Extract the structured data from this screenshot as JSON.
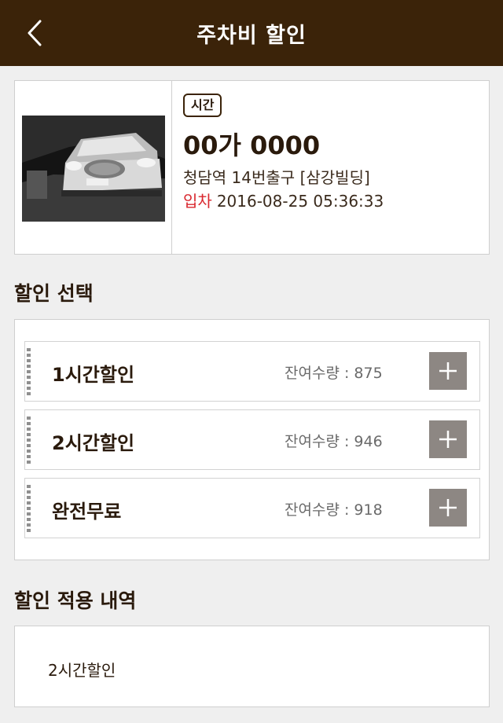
{
  "header": {
    "title": "주차비 할인",
    "back_icon": "chevron-left-icon"
  },
  "car": {
    "type_badge": "시간",
    "plate": "00가 0000",
    "location": "청담역 14번출구 [삼강빌딩]",
    "entry_label": "입차",
    "entry_time": "2016-08-25 05:36:33"
  },
  "discount_select": {
    "title": "할인 선택",
    "items": [
      {
        "name": "1시간할인",
        "remaining": "잔여수량 : 875",
        "add_icon": "plus-icon"
      },
      {
        "name": "2시간할인",
        "remaining": "잔여수량 : 946",
        "add_icon": "plus-icon"
      },
      {
        "name": "완전무료",
        "remaining": "잔여수량 : 918",
        "add_icon": "plus-icon"
      }
    ]
  },
  "history": {
    "title": "할인 적용 내역",
    "items": [
      "2시간할인"
    ]
  },
  "colors": {
    "header_bg": "#3b2309",
    "accent_red": "#d9272e",
    "add_button": "#8d8783",
    "page_bg": "#efefef"
  }
}
